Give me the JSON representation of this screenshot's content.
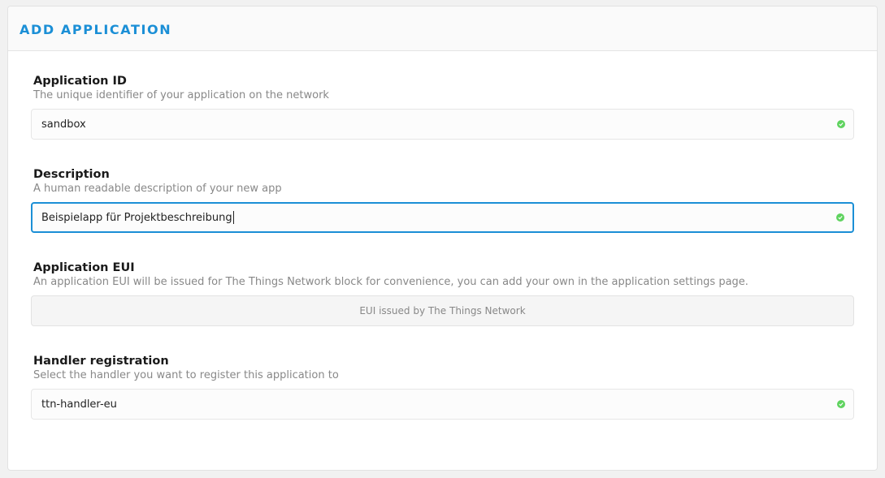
{
  "header": {
    "title": "ADD APPLICATION"
  },
  "fields": {
    "app_id": {
      "label": "Application ID",
      "description": "The unique identifier of your application on the network",
      "value": "sandbox",
      "valid_icon": "check-circle-icon"
    },
    "description": {
      "label": "Description",
      "description": "A human readable description of your new app",
      "value": "Beispielapp für Projektbeschreibung",
      "valid_icon": "check-circle-icon"
    },
    "app_eui": {
      "label": "Application EUI",
      "description": "An application EUI will be issued for The Things Network block for convenience, you can add your own in the application settings page.",
      "placeholder": "EUI issued by The Things Network"
    },
    "handler": {
      "label": "Handler registration",
      "description": "Select the handler you want to register this application to",
      "value": "ttn-handler-eu",
      "valid_icon": "check-circle-icon"
    }
  },
  "colors": {
    "accent": "#1b8fd6",
    "valid": "#5fd35f"
  }
}
